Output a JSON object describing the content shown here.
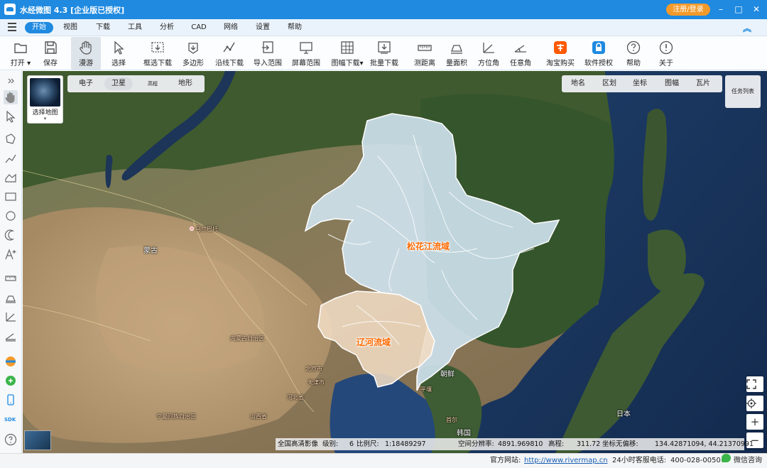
{
  "app": {
    "title": "水经微图 4.3 [企业版已授权]",
    "login_label": "注册/登录"
  },
  "window_controls": {
    "minimize": "–",
    "maximize": "□",
    "close": "✕"
  },
  "menu": {
    "items": [
      "开始",
      "视图",
      "下载",
      "工具",
      "分析",
      "CAD",
      "网络",
      "设置",
      "帮助"
    ],
    "active": "开始"
  },
  "toolbar": {
    "tools": [
      "打开",
      "保存",
      "漫游",
      "选择",
      "框选下载",
      "多边形",
      "沿线下载",
      "导入范围",
      "屏幕范围",
      "图幅下载",
      "批量下载",
      "测距离",
      "量面积",
      "方位角",
      "任意角",
      "淘宝购买",
      "软件授权",
      "帮助",
      "关于"
    ],
    "active": "漫游",
    "open_arrow": "▾",
    "sheet_arrow": "▾"
  },
  "map_type": {
    "thumb_label": "选择地图",
    "thumb_arrow": "▾",
    "options": [
      "电子",
      "卫星",
      "高程",
      "地形"
    ],
    "active": "卫星"
  },
  "layers": {
    "options": [
      "地名",
      "区划",
      "坐标",
      "图幅",
      "瓦片"
    ]
  },
  "task_list_label": "任务列表",
  "map_labels": {
    "songhua": "松花江流域",
    "liaohe": "辽河流域",
    "mongolia": "蒙古",
    "ulanbator": "乌兰巴托",
    "inner_mongolia": "内蒙古自治区",
    "beijing": "北京市",
    "tianjin": "天津市",
    "hebei": "河北省",
    "shanxi": "山西省",
    "ningxia": "宁夏回族自治区",
    "korea_n": "朝鲜",
    "pyongyang": "平壤",
    "korea_s": "韩国",
    "seoul": "首尔",
    "japan": "日本"
  },
  "status": {
    "source": "全国高清影像",
    "level_label": "级别:",
    "level": "6",
    "scale_label": "比例尺:",
    "scale": "1:18489297",
    "resolution_label": "空间分辨率:",
    "resolution": "4891.969810",
    "elevation_label": "高程:",
    "elevation": "311.72",
    "coord_label": "坐标无偏移:",
    "coord": "134.42871094, 44.21370991"
  },
  "footer": {
    "website_label": "官方网站:",
    "website": "http://www.rivermap.cn",
    "hotline_label": "24小时客服电话:",
    "hotline": "400-028-0050",
    "wechat": "微信咨询"
  },
  "colors": {
    "accent": "#1f8ae0",
    "login": "#f39a2b",
    "basin_songhua": "#cfe3f0",
    "basin_liaohe": "#f0dcc3",
    "basin_label": "#ff6a00"
  }
}
